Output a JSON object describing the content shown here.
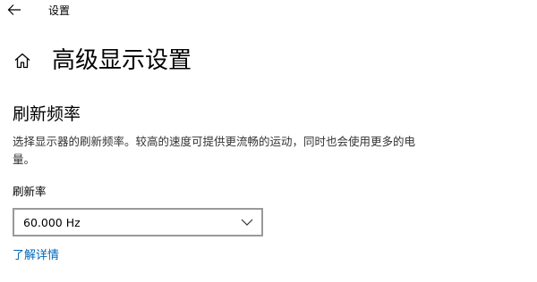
{
  "window": {
    "title": "设置",
    "back_icon": "back-arrow-icon"
  },
  "header": {
    "home_icon": "home-icon",
    "title": "高级显示设置"
  },
  "refresh_rate_section": {
    "heading": "刷新频率",
    "description": "选择显示器的刷新频率。较高的速度可提供更流畅的运动，同时也会使用更多的电量。",
    "field_label": "刷新率",
    "selected_value": "60.000 Hz",
    "dropdown_icon": "chevron-down-icon",
    "learn_more_link": "了解详情"
  },
  "colors": {
    "link": "#0067b8",
    "dropdown_border": "#999999",
    "background": "#ffffff"
  }
}
